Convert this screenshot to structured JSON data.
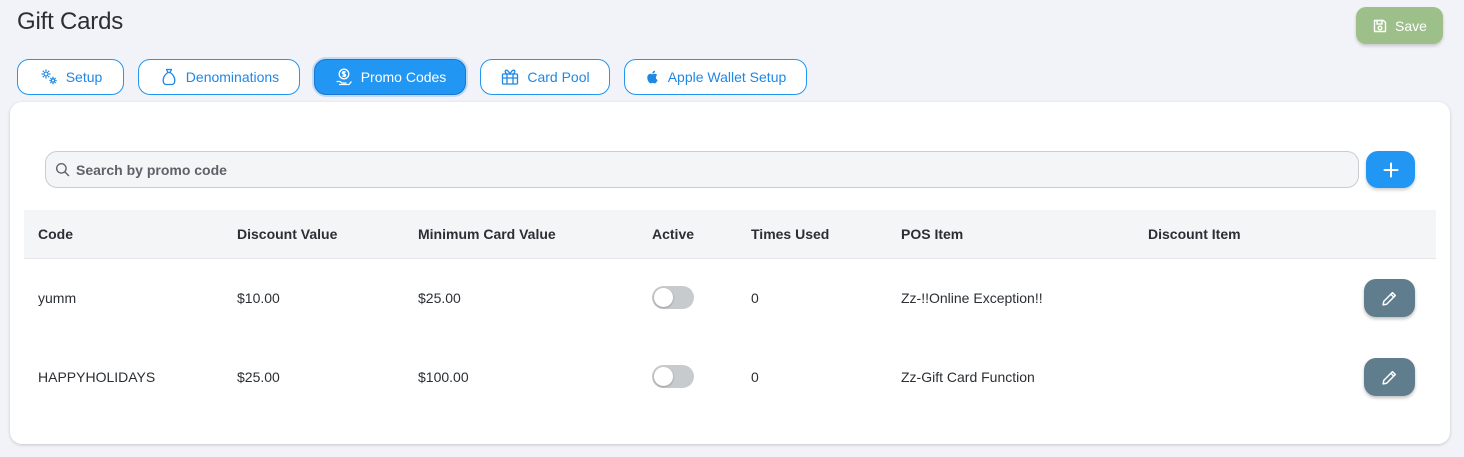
{
  "header": {
    "title": "Gift Cards",
    "save_label": "Save"
  },
  "tabs": [
    {
      "label": "Setup",
      "icon": "gears-icon",
      "active": false
    },
    {
      "label": "Denominations",
      "icon": "money-bag-icon",
      "active": false
    },
    {
      "label": "Promo Codes",
      "icon": "coin-hand-icon",
      "active": true
    },
    {
      "label": "Card Pool",
      "icon": "gift-icon",
      "active": false
    },
    {
      "label": "Apple Wallet Setup",
      "icon": "apple-icon",
      "active": false
    }
  ],
  "search": {
    "placeholder": "Search by promo code",
    "value": ""
  },
  "table": {
    "columns": [
      "Code",
      "Discount Value",
      "Minimum Card Value",
      "Active",
      "Times Used",
      "POS Item",
      "Discount Item"
    ],
    "rows": [
      {
        "code": "yumm",
        "discount_value": "$10.00",
        "min_card_value": "$25.00",
        "active": false,
        "times_used": "0",
        "pos_item": "Zz-!!Online Exception!!",
        "discount_item": ""
      },
      {
        "code": "HAPPYHOLIDAYS",
        "discount_value": "$25.00",
        "min_card_value": "$100.00",
        "active": false,
        "times_used": "0",
        "pos_item": "Zz-Gift Card Function",
        "discount_item": ""
      }
    ]
  },
  "colors": {
    "primary": "#2196f3",
    "save_disabled": "#9dc08a",
    "edit_button": "#5f7d8c",
    "toggle_off": "#c8cbce",
    "background": "#f1f3f8"
  }
}
